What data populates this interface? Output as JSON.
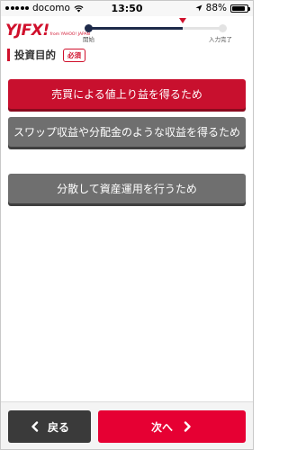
{
  "status_bar": {
    "carrier": "docomo",
    "time": "13:50",
    "battery": "88%",
    "battery_level": 0.88
  },
  "header": {
    "logo_text": "YJFX!",
    "logo_sub": "from YAHOO! JAPAN",
    "progress": {
      "start_label": "開始",
      "end_label": "入力完了",
      "fraction_complete": 0.7
    }
  },
  "section": {
    "title": "投資目的",
    "required_label": "必須"
  },
  "options": [
    {
      "label": "売買による値上り益を得るため",
      "selected": true
    },
    {
      "label": "スワップ収益や分配金のような収益を得るため",
      "selected": false
    },
    {
      "label": "分散して資産運用を行うため",
      "selected": false
    }
  ],
  "footer": {
    "back_label": "戻る",
    "next_label": "次へ"
  },
  "colors": {
    "accent": "#d0102c",
    "next_button": "#e60033",
    "back_button": "#3a3a3a",
    "unselected_option": "#6f6f6f",
    "progress_done": "#1e2a4a"
  }
}
